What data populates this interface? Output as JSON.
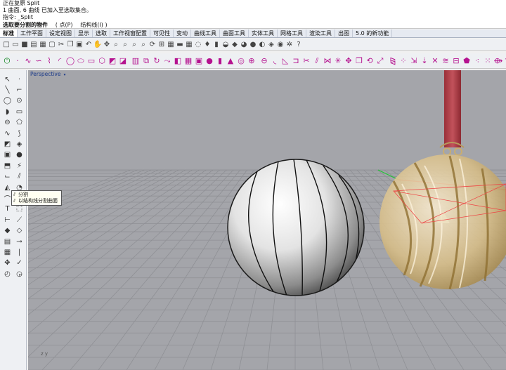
{
  "command_history": [
    "正在复原 Split",
    "1 曲面, 6 曲线 已加入至选取集合。",
    "指令: _Split"
  ],
  "prompt": {
    "text": "选取要分割的物件",
    "options": [
      "( 点(P)",
      "结构线(I) )"
    ]
  },
  "menu_tabs": [
    {
      "label": "标准",
      "active": true
    },
    {
      "label": "工作平面"
    },
    {
      "label": "设定视图"
    },
    {
      "label": "显示"
    },
    {
      "label": "选取"
    },
    {
      "label": "工作视窗配置"
    },
    {
      "label": "可见性"
    },
    {
      "label": "变动"
    },
    {
      "label": "曲线工具"
    },
    {
      "label": "曲面工具"
    },
    {
      "label": "实体工具"
    },
    {
      "label": "网格工具"
    },
    {
      "label": "渲染工具"
    },
    {
      "label": "出图"
    },
    {
      "label": "5.0 的新功能"
    }
  ],
  "toolbar_standard": [
    {
      "icon": "new-file-icon",
      "glyph": "□"
    },
    {
      "icon": "open-folder-icon",
      "glyph": "▭"
    },
    {
      "icon": "save-icon",
      "glyph": "■"
    },
    {
      "icon": "print-icon",
      "glyph": "▤"
    },
    {
      "icon": "import-icon",
      "glyph": "▦"
    },
    {
      "icon": "properties-icon",
      "glyph": "▢"
    },
    {
      "icon": "cut-icon",
      "glyph": "✂"
    },
    {
      "icon": "copy-icon",
      "glyph": "❐"
    },
    {
      "icon": "paste-icon",
      "glyph": "▣"
    },
    {
      "icon": "undo-icon",
      "glyph": "↶"
    },
    {
      "icon": "pan-hand-icon",
      "glyph": "✋"
    },
    {
      "icon": "pan-move-icon",
      "glyph": "✥"
    },
    {
      "icon": "zoom-icon",
      "glyph": "⌕"
    },
    {
      "icon": "zoom-window-icon",
      "glyph": "⌕"
    },
    {
      "icon": "zoom-extents-icon",
      "glyph": "⌕"
    },
    {
      "icon": "zoom-selected-icon",
      "glyph": "⌕"
    },
    {
      "icon": "rotate-view-icon",
      "glyph": "⟳"
    },
    {
      "icon": "four-viewports-icon",
      "glyph": "⊞"
    },
    {
      "icon": "cplane-icon",
      "glyph": "▦"
    },
    {
      "icon": "car-icon",
      "glyph": "▬"
    },
    {
      "icon": "grid-icon",
      "glyph": "▦"
    },
    {
      "icon": "select-icon",
      "glyph": "◌"
    },
    {
      "icon": "light-icon",
      "glyph": "♦"
    },
    {
      "icon": "lock-icon",
      "glyph": "▮"
    },
    {
      "icon": "bulb-icon",
      "glyph": "◒"
    },
    {
      "icon": "material-icon",
      "glyph": "◆"
    },
    {
      "icon": "color-wheel-icon",
      "glyph": "◕"
    },
    {
      "icon": "render-sphere-icon",
      "glyph": "●"
    },
    {
      "icon": "render-preview-icon",
      "glyph": "◐"
    },
    {
      "icon": "environment-icon",
      "glyph": "◈"
    },
    {
      "icon": "render-icon",
      "glyph": "◉"
    },
    {
      "icon": "options-gear-icon",
      "glyph": "✲"
    },
    {
      "icon": "help-icon",
      "glyph": "?"
    }
  ],
  "toolbar_magenta": [
    {
      "icon": "power-icon",
      "glyph": "⏻"
    },
    {
      "icon": "point-icon",
      "glyph": "·"
    },
    {
      "icon": "curve-control-icon",
      "glyph": "∿"
    },
    {
      "icon": "curve-interp-icon",
      "glyph": "∽"
    },
    {
      "icon": "polyline-icon",
      "glyph": "⌇"
    },
    {
      "icon": "arc-icon",
      "glyph": "◜"
    },
    {
      "icon": "circle-icon",
      "glyph": "◯"
    },
    {
      "icon": "ellipse-icon",
      "glyph": "⬭"
    },
    {
      "icon": "rectangle-icon",
      "glyph": "▭"
    },
    {
      "icon": "polygon-icon",
      "glyph": "⬡"
    },
    {
      "icon": "surface-corner-icon",
      "glyph": "◩"
    },
    {
      "icon": "surface-edge-icon",
      "glyph": "◪"
    },
    {
      "icon": "extrude-icon",
      "glyph": "▥"
    },
    {
      "icon": "loft-icon",
      "glyph": "⧉"
    },
    {
      "icon": "revolve-icon",
      "glyph": "↻"
    },
    {
      "icon": "sweep-icon",
      "glyph": "⤳"
    },
    {
      "icon": "patch-icon",
      "glyph": "◧"
    },
    {
      "icon": "network-icon",
      "glyph": "▦"
    },
    {
      "icon": "box-icon",
      "glyph": "▣"
    },
    {
      "icon": "sphere-solid-icon",
      "glyph": "●"
    },
    {
      "icon": "cylinder-icon",
      "glyph": "▮"
    },
    {
      "icon": "cone-icon",
      "glyph": "▲"
    },
    {
      "icon": "torus-icon",
      "glyph": "◎"
    },
    {
      "icon": "boolean-union-icon",
      "glyph": "⊕"
    },
    {
      "icon": "boolean-diff-icon",
      "glyph": "⊖"
    },
    {
      "icon": "fillet-icon",
      "glyph": "◟"
    },
    {
      "icon": "chamfer-icon",
      "glyph": "◺"
    },
    {
      "icon": "offset-icon",
      "glyph": "⊐"
    },
    {
      "icon": "trim-icon",
      "glyph": "✂"
    },
    {
      "icon": "split-icon",
      "glyph": "⫽"
    },
    {
      "icon": "join-icon",
      "glyph": "⋈"
    },
    {
      "icon": "explode-icon",
      "glyph": "✳"
    },
    {
      "icon": "move-icon",
      "glyph": "✥"
    },
    {
      "icon": "copy-object-icon",
      "glyph": "❐"
    },
    {
      "icon": "rotate-icon",
      "glyph": "⟲"
    },
    {
      "icon": "scale-icon",
      "glyph": "⤢"
    },
    {
      "icon": "mirror-icon",
      "glyph": "⧎"
    },
    {
      "icon": "array-icon",
      "glyph": "⁘"
    },
    {
      "icon": "orient-icon",
      "glyph": "⇲"
    },
    {
      "icon": "project-icon",
      "glyph": "⇣"
    },
    {
      "icon": "intersect-icon",
      "glyph": "✕"
    },
    {
      "icon": "contour-icon",
      "glyph": "≋"
    },
    {
      "icon": "section-icon",
      "glyph": "⊟"
    },
    {
      "icon": "pentagon-icon",
      "glyph": "⬟"
    },
    {
      "icon": "points-on-icon",
      "glyph": "⁖"
    },
    {
      "icon": "points-off-icon",
      "glyph": "⁙"
    },
    {
      "icon": "rebuild-icon",
      "glyph": "⟴"
    },
    {
      "icon": "analyze-icon",
      "glyph": "⌒"
    },
    {
      "icon": "camera-icon",
      "glyph": "▣"
    },
    {
      "icon": "dimension-icon",
      "glyph": "↔"
    }
  ],
  "sidebar_tools": [
    {
      "icon": "select-arrow-icon",
      "glyph": "↖"
    },
    {
      "icon": "point-tool-icon",
      "glyph": "·"
    },
    {
      "icon": "line-tool-icon",
      "glyph": "╲"
    },
    {
      "icon": "polyline-tool-icon",
      "glyph": "⌐"
    },
    {
      "icon": "circle-tool-icon",
      "glyph": "◯"
    },
    {
      "icon": "circle-center-icon",
      "glyph": "⊙"
    },
    {
      "icon": "curve-tool-icon",
      "glyph": "◗"
    },
    {
      "icon": "rect-tool-icon",
      "glyph": "▭"
    },
    {
      "icon": "ellipse-tool-icon",
      "glyph": "⊖"
    },
    {
      "icon": "polygon-tool-icon",
      "glyph": "⬠"
    },
    {
      "icon": "free-curve-icon",
      "glyph": "∿"
    },
    {
      "icon": "spiral-icon",
      "glyph": "⟆"
    },
    {
      "icon": "surface-tool-icon",
      "glyph": "◩"
    },
    {
      "icon": "surface-patch-icon",
      "glyph": "◈"
    },
    {
      "icon": "solid-box-icon",
      "glyph": "▣"
    },
    {
      "icon": "solid-sphere-icon",
      "glyph": "●"
    },
    {
      "icon": "extrude-tool-icon",
      "glyph": "⬒"
    },
    {
      "icon": "blend-tool-icon",
      "glyph": "⚡"
    },
    {
      "icon": "fillet-tool-icon",
      "glyph": "⌙"
    },
    {
      "icon": "split-tool-icon",
      "glyph": "⫽"
    },
    {
      "icon": "mesh-tool-icon",
      "glyph": "◭"
    },
    {
      "icon": "render-tool-icon",
      "glyph": "◔"
    },
    {
      "icon": "trim-tool-icon",
      "glyph": "⌒"
    },
    {
      "icon": "join-tool-icon",
      "glyph": "⟍"
    },
    {
      "icon": "explode-tool-icon",
      "glyph": "T"
    },
    {
      "icon": "text-tool-icon",
      "glyph": "⬚"
    },
    {
      "icon": "dim-tool-icon",
      "glyph": "⊢"
    },
    {
      "icon": "leader-tool-icon",
      "glyph": "⟋"
    },
    {
      "icon": "group-tool-icon",
      "glyph": "◆"
    },
    {
      "icon": "block-tool-icon",
      "glyph": "◇"
    },
    {
      "icon": "layer-tool-icon",
      "glyph": "▤"
    },
    {
      "icon": "hatch-tool-icon",
      "glyph": "⊸"
    },
    {
      "icon": "grid-tool-icon",
      "glyph": "▦"
    },
    {
      "icon": "analyze-tool-icon",
      "glyph": "❘"
    },
    {
      "icon": "move-tool-icon",
      "glyph": "✥"
    },
    {
      "icon": "check-tool-icon",
      "glyph": "✓"
    },
    {
      "icon": "history-tool-icon",
      "glyph": "◴"
    },
    {
      "icon": "hide-tool-icon",
      "glyph": "◶"
    }
  ],
  "viewport": {
    "label": "Perspective",
    "dropdown_glyph": "▾",
    "background": "#a4a5aa",
    "grid_color": "#8f9095",
    "axes_label": "z   y"
  },
  "tooltip": {
    "items": [
      {
        "icon": "split-icon",
        "glyph": "⫽",
        "label": "分割"
      },
      {
        "icon": "split-isocurve-icon",
        "glyph": "⫽",
        "label": "以结构线分割曲面"
      }
    ]
  },
  "colors": {
    "magenta_icons": "#b5128f",
    "gold": "#d6bd88",
    "ribbon": "#b4414a"
  }
}
